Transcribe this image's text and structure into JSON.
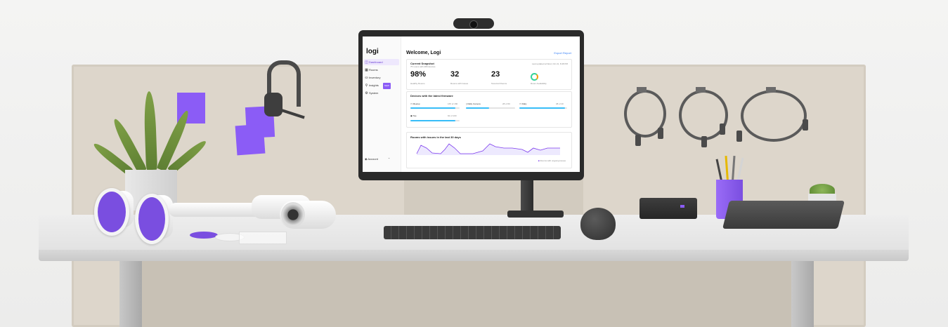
{
  "screen": {
    "logo": "logi",
    "title": "Welcome, Logi",
    "export_label": "Export Report",
    "nav": [
      {
        "label": "Dashboard",
        "icon": "dashboard-icon",
        "glyph": "◫"
      },
      {
        "label": "Rooms",
        "icon": "rooms-icon",
        "glyph": "▦"
      },
      {
        "label": "Inventory",
        "icon": "inventory-icon",
        "glyph": "⛀"
      },
      {
        "label": "Insights",
        "icon": "insights-icon",
        "glyph": "⚲",
        "badge": "NEW"
      },
      {
        "label": "System",
        "icon": "system-icon",
        "glyph": "⚙"
      }
    ],
    "account_label": "Account",
    "snapshot": {
      "title": "Current Snapshot",
      "subtitle": "75 rooms with 289 devices",
      "updated": "Last updated at Wed, Oct 21, 8:48 PM",
      "stats": [
        {
          "value": "98%",
          "label": "Healthy Rooms"
        },
        {
          "value": "32",
          "label": "Rooms with Issues"
        },
        {
          "value": "23",
          "label": "Snoozed Rooms"
        },
        {
          "label": "Room Availability"
        }
      ]
    },
    "firmware": {
      "title": "Devices with the latest firmware",
      "devices": [
        {
          "name": "Meetup",
          "count": "165 of 180",
          "progress": 0.92
        },
        {
          "name": "Rally Camera",
          "count": "28 of 60",
          "progress": 0.47
        },
        {
          "name": "Rally",
          "count": "38 of 40",
          "progress": 0.95
        },
        {
          "name": "Tap",
          "count": "92 of 100",
          "progress": 0.92
        }
      ]
    },
    "issues": {
      "title": "Rooms with issues in the last 30 days",
      "legend": "Rooms with ongoing issues"
    }
  },
  "colors": {
    "accent": "#8b5cf6",
    "progress": "#38bdf8",
    "link": "#3b82f6"
  }
}
